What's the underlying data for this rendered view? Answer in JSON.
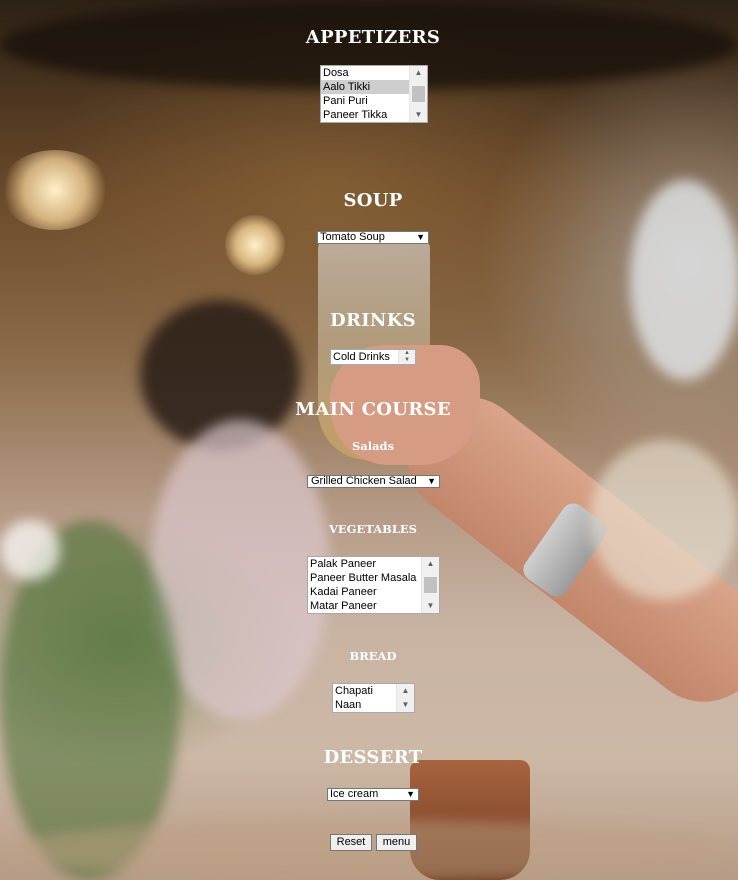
{
  "appetizers": {
    "heading": "APPETIZERS",
    "options": [
      "Dosa",
      "Aalo Tikki",
      "Pani Puri",
      "Paneer Tikka"
    ],
    "selected_index": 1
  },
  "soup": {
    "heading": "SOUP",
    "selected": "Tomato Soup"
  },
  "drinks": {
    "heading": "DRINKS",
    "options": [
      "Cold Drinks"
    ]
  },
  "main_course": {
    "heading": "MAIN COURSE",
    "salads": {
      "heading": "Salads",
      "selected": "Grilled Chicken Salad"
    },
    "vegetables": {
      "heading": "VEGETABLES",
      "options": [
        "Palak Paneer",
        "Paneer Butter Masala",
        "Kadai Paneer",
        "Matar Paneer"
      ]
    },
    "bread": {
      "heading": "BREAD",
      "options": [
        "Chapati",
        "Naan"
      ]
    }
  },
  "dessert": {
    "heading": "DESSERT",
    "selected": "Ice cream"
  },
  "buttons": {
    "reset": "Reset",
    "menu": "menu"
  },
  "icons": {
    "caret": "dropdown-caret-icon",
    "scroll_up": "scroll-up-arrow-icon",
    "scroll_down": "scroll-down-arrow-icon"
  }
}
